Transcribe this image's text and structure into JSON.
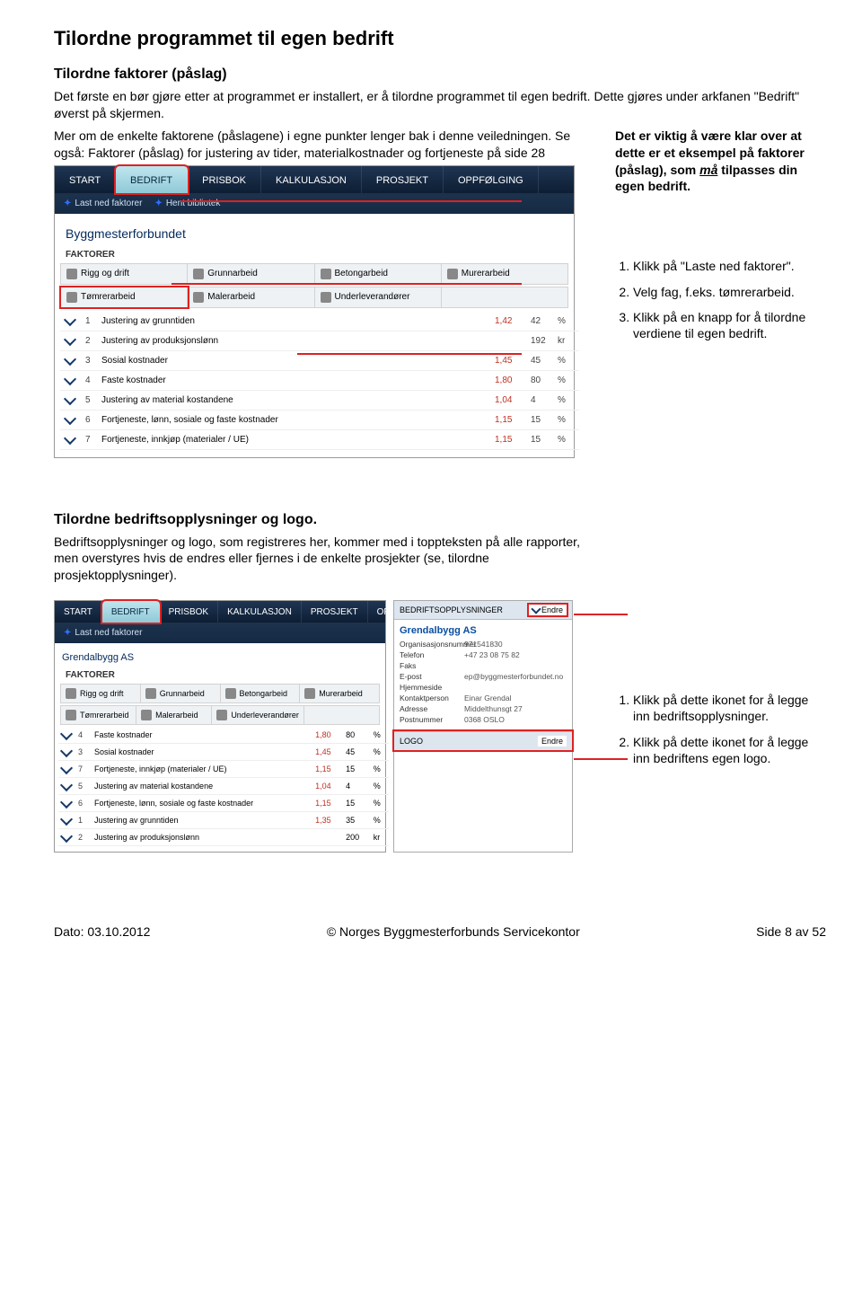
{
  "page": {
    "title": "Tilordne programmet til egen bedrift",
    "sub1_title": "Tilordne faktorer (påslag)",
    "intro1": "Det første en bør gjøre etter at programmet er installert, er å tilordne programmet til egen bedrift. Dette gjøres under arkfanen \"Bedrift\" øverst på skjermen.",
    "intro2": "Mer om de enkelte faktorene (påslagene) i egne punkter lenger bak i denne veiledningen. Se også: Faktorer (påslag) for justering av tider, materialkostnader og fortjeneste på side 28"
  },
  "side_note": {
    "l1": "Det er viktig å være klar over at dette er et eksempel på faktorer (påslag), som ",
    "emph": "må",
    "l2": " tilpasses din egen bedrift."
  },
  "side_list1": {
    "i1": "Klikk på \"Laste ned faktorer\".",
    "i2": "Velg fag, f.eks. tømrerarbeid.",
    "i3": "Klikk på en knapp for å tilordne verdiene til egen bedrift."
  },
  "nav": {
    "start": "START",
    "bedrift": "BEDRIFT",
    "prisbok": "PRISBOK",
    "kalkulasjon": "KALKULASJON",
    "prosjekt": "PROSJEKT",
    "oppfolging": "OPPFØLGING"
  },
  "subnav": {
    "lastned": "Last ned faktorer",
    "hent": "Hent bibliotek"
  },
  "panel": {
    "company": "Byggmesterforbundet",
    "company2": "Grendalbygg AS",
    "section": "FAKTORER"
  },
  "cats": {
    "rigg": "Rigg og drift",
    "grunn": "Grunnarbeid",
    "betong": "Betongarbeid",
    "murer": "Murerarbeid",
    "tomrer": "Tømrerarbeid",
    "maler": "Malerarbeid",
    "under": "Underleverandører"
  },
  "rows1": [
    {
      "n": "1",
      "label": "Justering av grunntiden",
      "v": "1,42",
      "p": "42",
      "u": "%"
    },
    {
      "n": "2",
      "label": "Justering av produksjonslønn",
      "v": "",
      "p": "192",
      "u": "kr"
    },
    {
      "n": "3",
      "label": "Sosial kostnader",
      "v": "1,45",
      "p": "45",
      "u": "%"
    },
    {
      "n": "4",
      "label": "Faste kostnader",
      "v": "1,80",
      "p": "80",
      "u": "%"
    },
    {
      "n": "5",
      "label": "Justering av material kostandene",
      "v": "1,04",
      "p": "4",
      "u": "%"
    },
    {
      "n": "6",
      "label": "Fortjeneste, lønn, sosiale og faste kostnader",
      "v": "1,15",
      "p": "15",
      "u": "%"
    },
    {
      "n": "7",
      "label": "Fortjeneste, innkjøp (materialer / UE)",
      "v": "1,15",
      "p": "15",
      "u": "%"
    }
  ],
  "section2": {
    "title": "Tilordne bedriftsopplysninger og logo.",
    "p": "Bedriftsopplysninger og logo, som registreres her, kommer med i toppteksten på alle rapporter, men overstyres hvis de endres eller fjernes i de enkelte prosjekter (se, tilordne prosjektopplysninger)."
  },
  "rows2": [
    {
      "n": "4",
      "label": "Faste kostnader",
      "v": "1,80",
      "p": "80",
      "u": "%"
    },
    {
      "n": "3",
      "label": "Sosial kostnader",
      "v": "1,45",
      "p": "45",
      "u": "%"
    },
    {
      "n": "7",
      "label": "Fortjeneste, innkjøp (materialer / UE)",
      "v": "1,15",
      "p": "15",
      "u": "%"
    },
    {
      "n": "5",
      "label": "Justering av material kostandene",
      "v": "1,04",
      "p": "4",
      "u": "%"
    },
    {
      "n": "6",
      "label": "Fortjeneste, lønn, sosiale og faste kostnader",
      "v": "1,15",
      "p": "15",
      "u": "%"
    },
    {
      "n": "1",
      "label": "Justering av grunntiden",
      "v": "1,35",
      "p": "35",
      "u": "%"
    },
    {
      "n": "2",
      "label": "Justering av produksjonslønn",
      "v": "",
      "p": "200",
      "u": "kr"
    }
  ],
  "info": {
    "head": "BEDRIFTSOPPLYSNINGER",
    "endre": "Endre",
    "name": "Grendalbygg AS",
    "orgnr_k": "Organisasjonsnummer",
    "orgnr_v": "971541830",
    "tlf_k": "Telefon",
    "tlf_v": "+47 23 08 75 82",
    "faks_k": "Faks",
    "faks_v": "",
    "epost_k": "E-post",
    "epost_v": "ep@byggmesterforbundet.no",
    "hjem_k": "Hjemmeside",
    "hjem_v": "",
    "kontakt_k": "Kontaktperson",
    "kontakt_v": "Einar Grendal",
    "adresse_k": "Adresse",
    "adresse_v": "Middelthunsgt 27",
    "post_k": "Postnummer",
    "post_v": "0368  OSLO",
    "logo_head": "LOGO"
  },
  "side_list2": {
    "i1": "Klikk på dette ikonet for å legge inn bedriftsopplysninger.",
    "i2": "Klikk på dette ikonet for å legge inn bedriftens egen logo."
  },
  "footer": {
    "date": "Dato: 03.10.2012",
    "org": "© Norges Byggmesterforbunds Servicekontor",
    "page": "Side 8 av 52"
  }
}
